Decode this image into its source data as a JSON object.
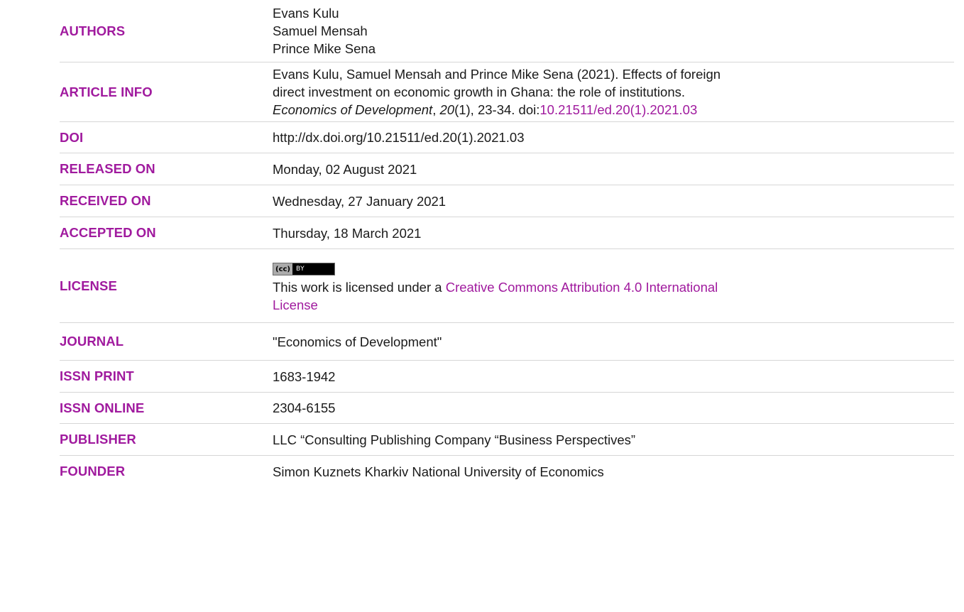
{
  "rows": [
    {
      "label": "AUTHORS",
      "lines": [
        "Evans Kulu",
        "Samuel Mensah",
        "Prince Mike Sena"
      ]
    },
    {
      "label": "ARTICLE INFO",
      "line1": "Evans Kulu, Samuel Mensah and Prince Mike Sena (2021). Effects of foreign",
      "line2": "direct investment on economic growth in Ghana: the role of institutions.",
      "journal_italic": "Economics of Development",
      "comma1": ", ",
      "volume_italic": "20",
      "pages": "(1), 23-34. doi:",
      "doi_link": "10.21511/ed.20(1).2021.03"
    },
    {
      "label": "DOI",
      "value": "http://dx.doi.org/10.21511/ed.20(1).2021.03"
    },
    {
      "label": "RELEASED ON",
      "value": "Monday, 02 August 2021"
    },
    {
      "label": "RECEIVED ON",
      "value": "Wednesday, 27 January 2021"
    },
    {
      "label": "ACCEPTED ON",
      "value": "Thursday, 18 March 2021"
    },
    {
      "label": "LICENSE",
      "badge_cc": "(cc)",
      "badge_by": "BY",
      "text": "This work is licensed under a ",
      "link_line1": "Creative Commons Attribution 4.0 International",
      "link_line2": "License"
    },
    {
      "label": "JOURNAL",
      "value": "\"Economics of Development\""
    },
    {
      "label": "ISSN PRINT",
      "value": "1683-1942"
    },
    {
      "label": "ISSN ONLINE",
      "value": "2304-6155"
    },
    {
      "label": "PUBLISHER",
      "value": "LLC “Consulting Publishing Company “Business Perspectives”"
    },
    {
      "label": "FOUNDER",
      "value": "Simon Kuznets Kharkiv National University of Economics"
    }
  ],
  "colors": {
    "label": "#a01a9e",
    "link": "#a01a9e",
    "text": "#1a1a1a",
    "divider": "#d6d6d6"
  }
}
